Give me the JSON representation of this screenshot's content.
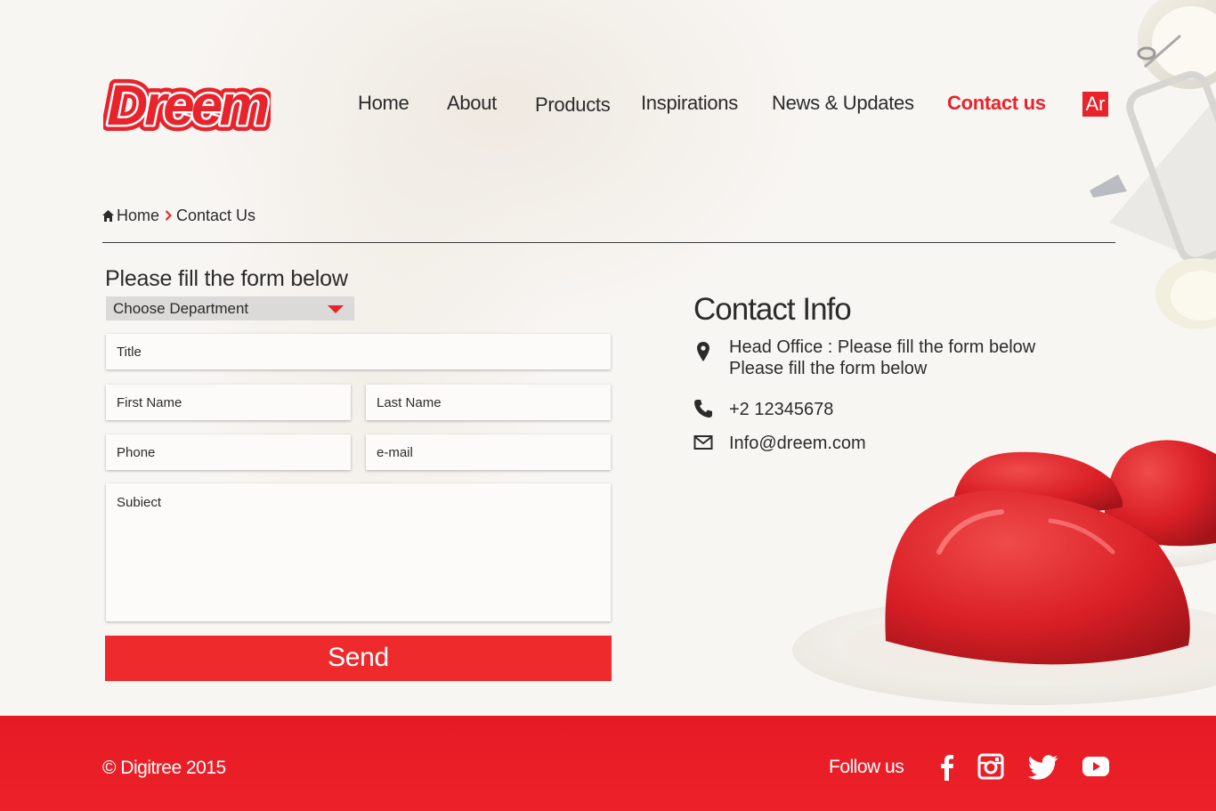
{
  "brand": {
    "logo_text": "Dreem",
    "accent": "#e8232b"
  },
  "nav": {
    "items": [
      {
        "label": "Home",
        "active": false
      },
      {
        "label": "About",
        "active": false
      },
      {
        "label": "Products",
        "active": false
      },
      {
        "label": "Inspirations",
        "active": false
      },
      {
        "label": "News & Updates",
        "active": false
      },
      {
        "label": "Contact us",
        "active": true
      }
    ],
    "lang_label": "Ar"
  },
  "breadcrumb": {
    "home": "Home",
    "current": "Contact Us"
  },
  "form": {
    "heading": "Please fill the form below",
    "department_select": "Choose Department",
    "title_placeholder": "Title",
    "first_name_placeholder": "First Name",
    "last_name_placeholder": "Last Name",
    "phone_placeholder": "Phone",
    "email_placeholder": "e-mail",
    "subject_placeholder": "Subiect",
    "send_label": "Send"
  },
  "contact_info": {
    "title": "Contact Info",
    "address_line1": "Head Office : Please fill the form below",
    "address_line2": "Please fill the form below",
    "phone": "+2 12345678",
    "email": "Info@dreem.com"
  },
  "footer": {
    "copyright": "© Digitree 2015",
    "follow_label": "Follow us",
    "social_icons": [
      "facebook-icon",
      "instagram-icon",
      "twitter-icon",
      "youtube-icon"
    ]
  }
}
